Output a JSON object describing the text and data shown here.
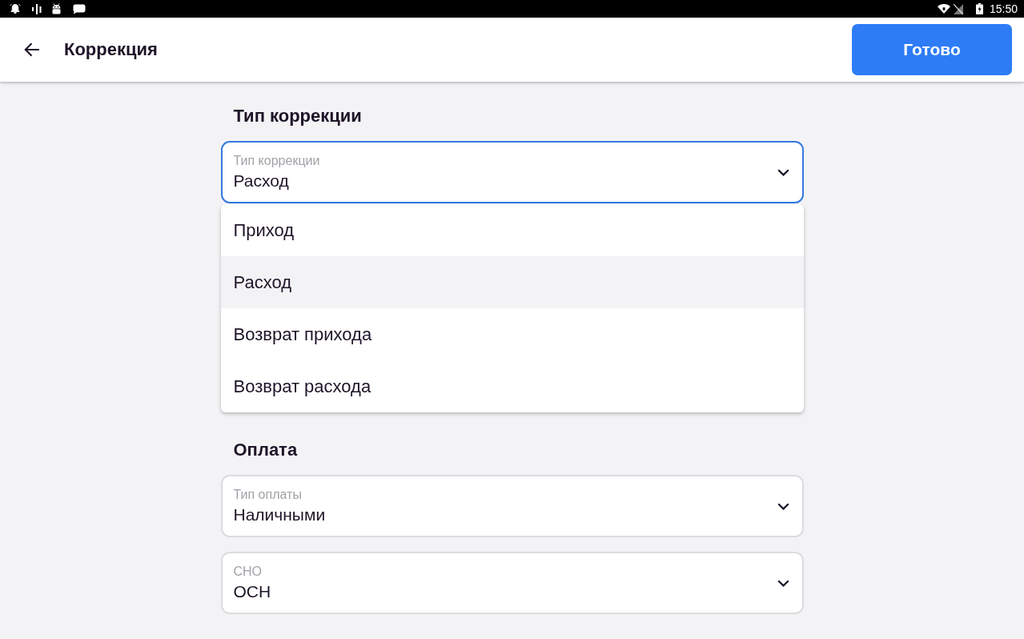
{
  "status_bar": {
    "time": "15:50"
  },
  "header": {
    "title": "Коррекция",
    "done_button": "Готово"
  },
  "sections": [
    {
      "title": "Тип коррекции",
      "fields": [
        {
          "label": "Тип коррекции",
          "value": "Расход",
          "expanded": true,
          "options": [
            {
              "label": "Приход",
              "selected": false
            },
            {
              "label": "Расход",
              "selected": true
            },
            {
              "label": "Возврат прихода",
              "selected": false
            },
            {
              "label": "Возврат расхода",
              "selected": false
            }
          ]
        }
      ]
    },
    {
      "title": "Оплата",
      "fields": [
        {
          "label": "Тип оплаты",
          "value": "Наличными",
          "expanded": false
        },
        {
          "label": "СНО",
          "value": "ОСН",
          "expanded": false
        }
      ]
    }
  ]
}
